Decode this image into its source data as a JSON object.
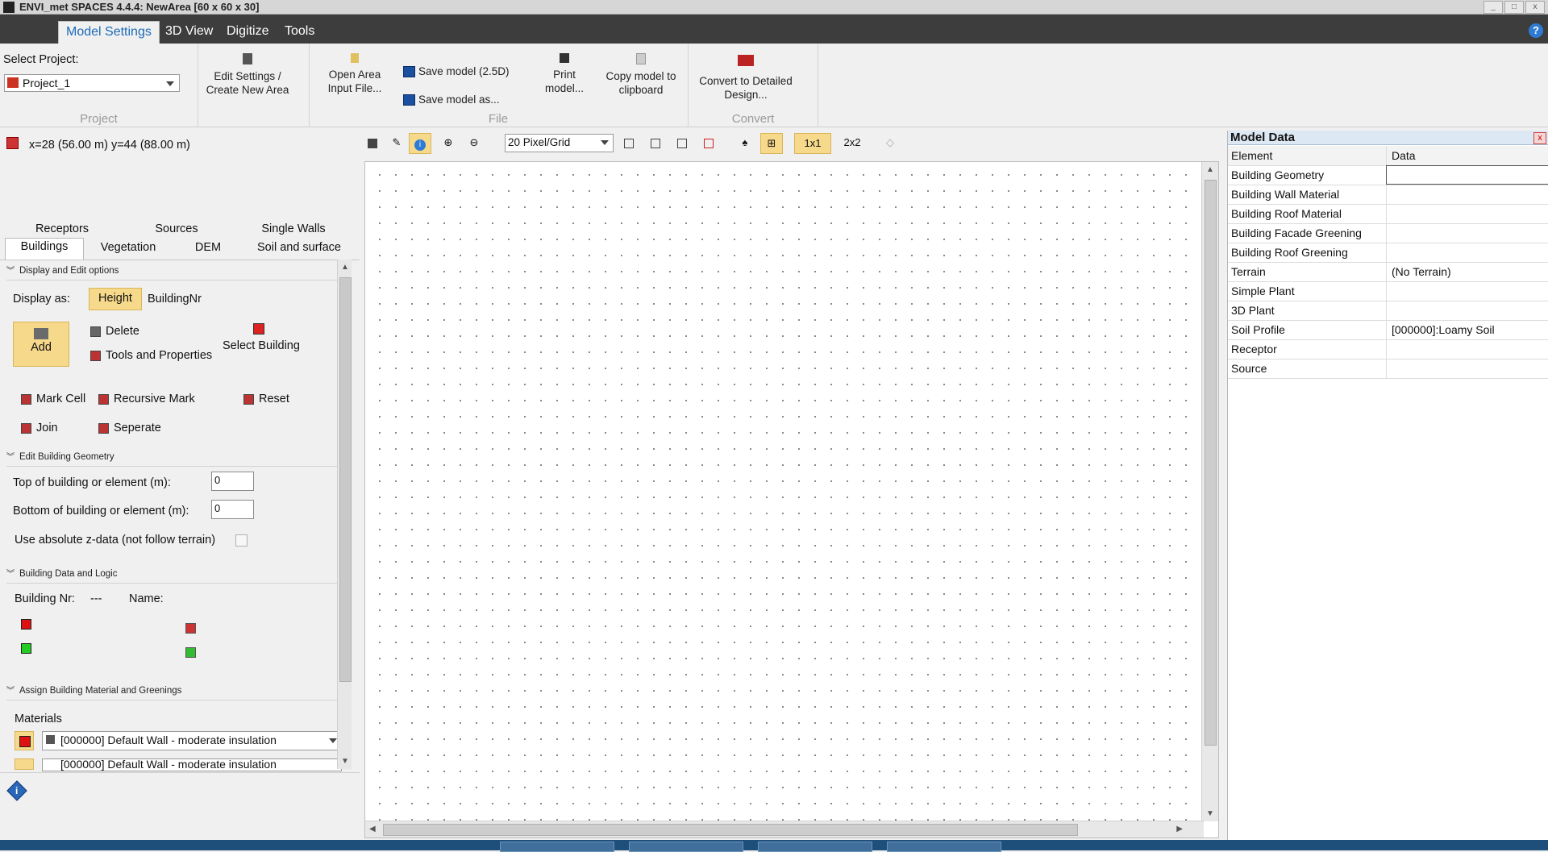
{
  "window": {
    "title": "ENVI_met SPACES 4.4.4:  NewArea [60 x 60 x 30]",
    "help_glyph": "?"
  },
  "menu": {
    "items": [
      "Model Settings",
      "3D View",
      "Digitize",
      "Tools"
    ],
    "active": "Model Settings"
  },
  "ribbon": {
    "project": {
      "select_label": "Select Project:",
      "selected": "Project_1",
      "edit_line1": "Edit Settings /",
      "edit_line2": "Create New Area",
      "group_label": "Project"
    },
    "file": {
      "open_line1": "Open Area",
      "open_line2": "Input File...",
      "save_25d": "Save model (2.5D)",
      "save_as": "Save model as...",
      "print_line1": "Print",
      "print_line2": "model...",
      "copy_line1": "Copy model to",
      "copy_line2": "clipboard",
      "group_label": "File"
    },
    "convert": {
      "line1": "Convert to Detailed",
      "line2": "Design...",
      "group_label": "Convert"
    }
  },
  "coordinates": "x=28 (56.00 m) y=44 (88.00 m)",
  "tabs": {
    "row1": [
      "Receptors",
      "Sources",
      "Single Walls"
    ],
    "row2": [
      "Buildings",
      "Vegetation",
      "DEM",
      "Soil and surface"
    ],
    "selected": "Buildings"
  },
  "display_options": {
    "header": "Display and Edit options",
    "display_as_label": "Display as:",
    "height_button": "Height",
    "buildingnr_button": "BuildingNr",
    "add_button": "Add",
    "delete": "Delete",
    "tools_properties": "Tools and Properties",
    "select_building": "Select Building",
    "mark_cell": "Mark Cell",
    "recursive_mark": "Recursive Mark",
    "reset": "Reset",
    "join": "Join",
    "seperate": "Seperate"
  },
  "geometry": {
    "header": "Edit Building Geometry",
    "top_label": "Top of building or element (m):",
    "top_value": "0",
    "bottom_label": "Bottom of building or element (m):",
    "bottom_value": "0",
    "absolute_label": "Use absolute z-data (not follow terrain)"
  },
  "building_data": {
    "header": "Building Data and Logic",
    "nr_label": "Building Nr:",
    "nr_value": "---",
    "name_label": "Name:"
  },
  "materials": {
    "header": "Assign Building Material and Greenings",
    "label": "Materials",
    "wall1": "[000000] Default Wall - moderate insulation",
    "wall2": "[000000] Default Wall - moderate insulation"
  },
  "map_toolbar": {
    "zoom": "20 Pixel/Grid",
    "btn_1x1": "1x1",
    "btn_2x2": "2x2"
  },
  "model_data": {
    "title": "Model Data",
    "close_glyph": "x",
    "col_element": "Element",
    "col_data": "Data",
    "rows": [
      {
        "element": "Building Geometry",
        "data": ""
      },
      {
        "element": "Building Wall Material",
        "data": ""
      },
      {
        "element": "Building Roof Material",
        "data": ""
      },
      {
        "element": "Building Facade Greening",
        "data": ""
      },
      {
        "element": "Building Roof Greening",
        "data": ""
      },
      {
        "element": "Terrain",
        "data": "(No Terrain)"
      },
      {
        "element": "Simple Plant",
        "data": ""
      },
      {
        "element": "3D Plant",
        "data": ""
      },
      {
        "element": "Soil Profile",
        "data": "[000000]:Loamy Soil"
      },
      {
        "element": "Receptor",
        "data": ""
      },
      {
        "element": "Source",
        "data": ""
      }
    ]
  },
  "colors": {
    "accent": "#1d6ab8",
    "menubar": "#3d3d3d",
    "active_button": "#f7d98b"
  },
  "icons": [
    "project-icon",
    "edit-settings-icon",
    "open-file-icon",
    "save-icon",
    "print-icon",
    "copy-icon",
    "convert-icon",
    "info-icon",
    "zoom-in-icon",
    "zoom-out-icon"
  ]
}
